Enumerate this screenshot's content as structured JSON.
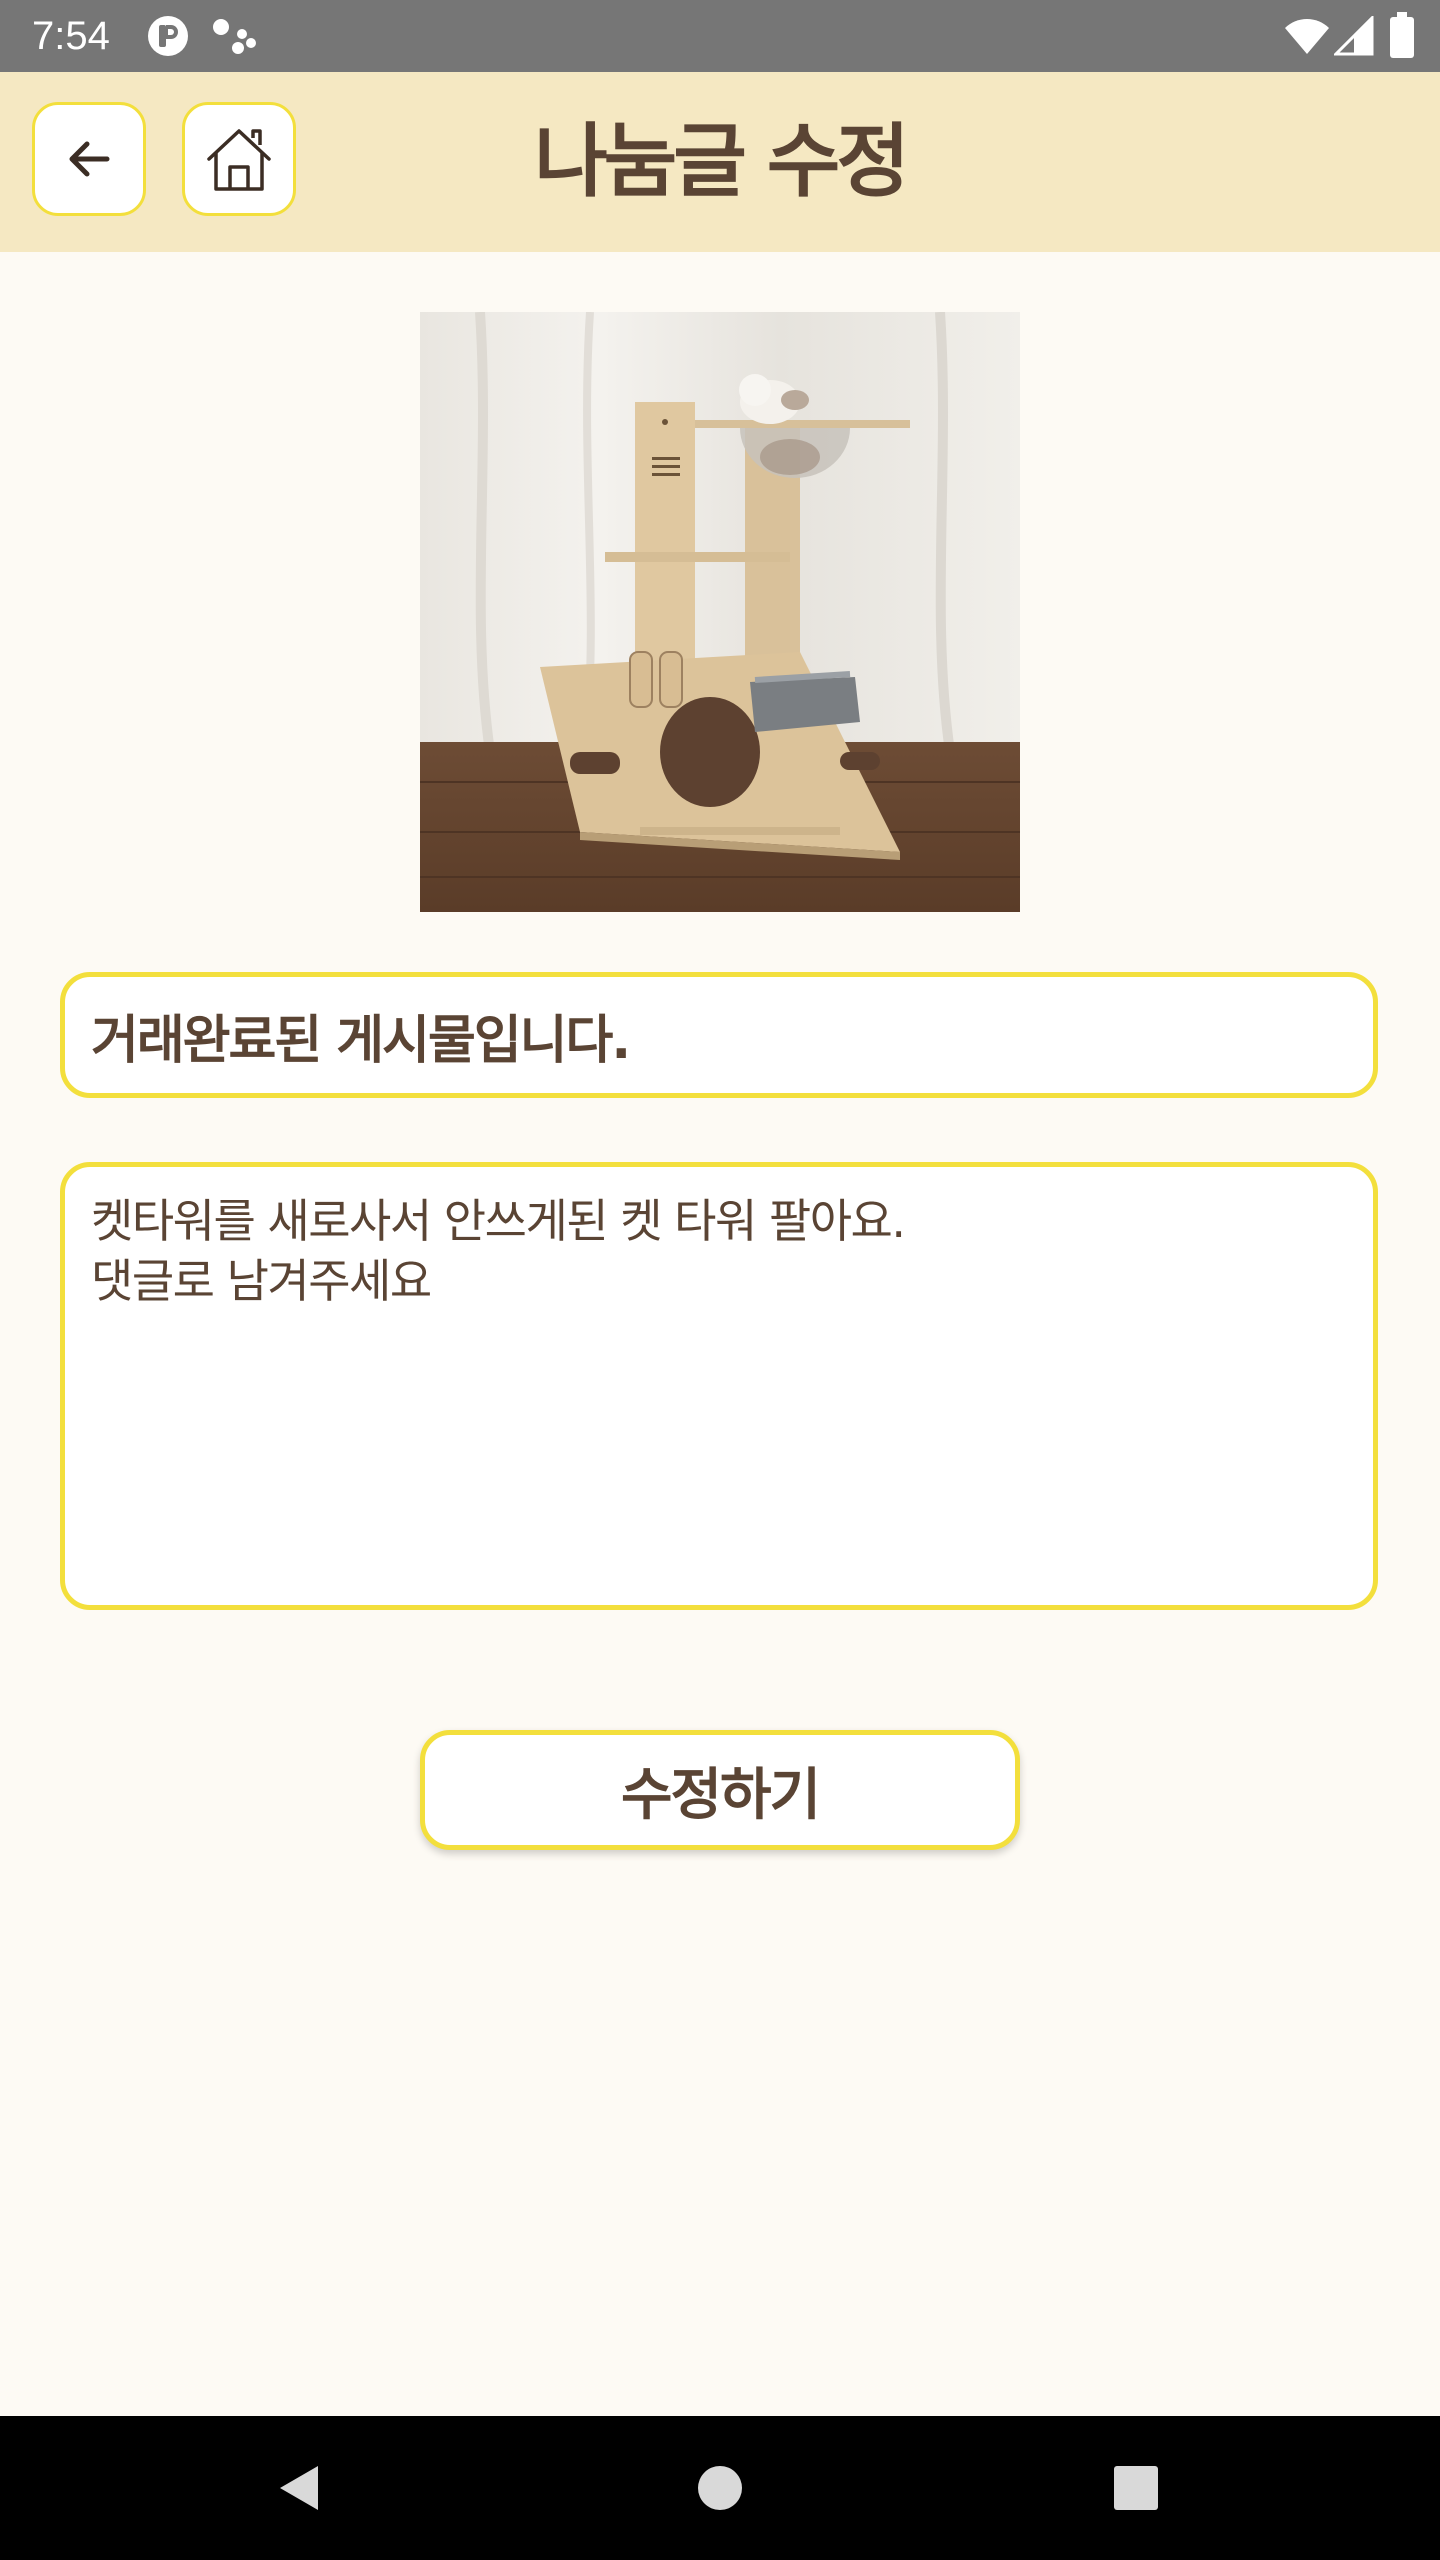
{
  "status_bar": {
    "time": "7:54",
    "icons": [
      "app-notification-icon",
      "assistant-dots-icon",
      "wifi-icon",
      "cellular-signal-icon",
      "battery-icon"
    ]
  },
  "header": {
    "title": "나눔글 수정",
    "back_icon": "arrow-left-icon",
    "home_icon": "home-icon",
    "background_color": "#f5e8c2",
    "accent_color": "#f3df3c"
  },
  "post": {
    "photo_subject": "cat tower",
    "title_value": "거래완료된 게시물입니다.",
    "content_value": "켓타워를 새로사서 안쓰게된 켓 타워 팔아요.\n댓글로 남겨주세요"
  },
  "actions": {
    "submit_label": "수정하기"
  },
  "nav_bar": {
    "icons": [
      "nav-back-icon",
      "nav-home-icon",
      "nav-recents-icon"
    ]
  },
  "colors": {
    "text": "#5a4434",
    "page_background": "#fdfaf4",
    "status_bar": "#767676",
    "border_yellow": "#f3df3c"
  }
}
